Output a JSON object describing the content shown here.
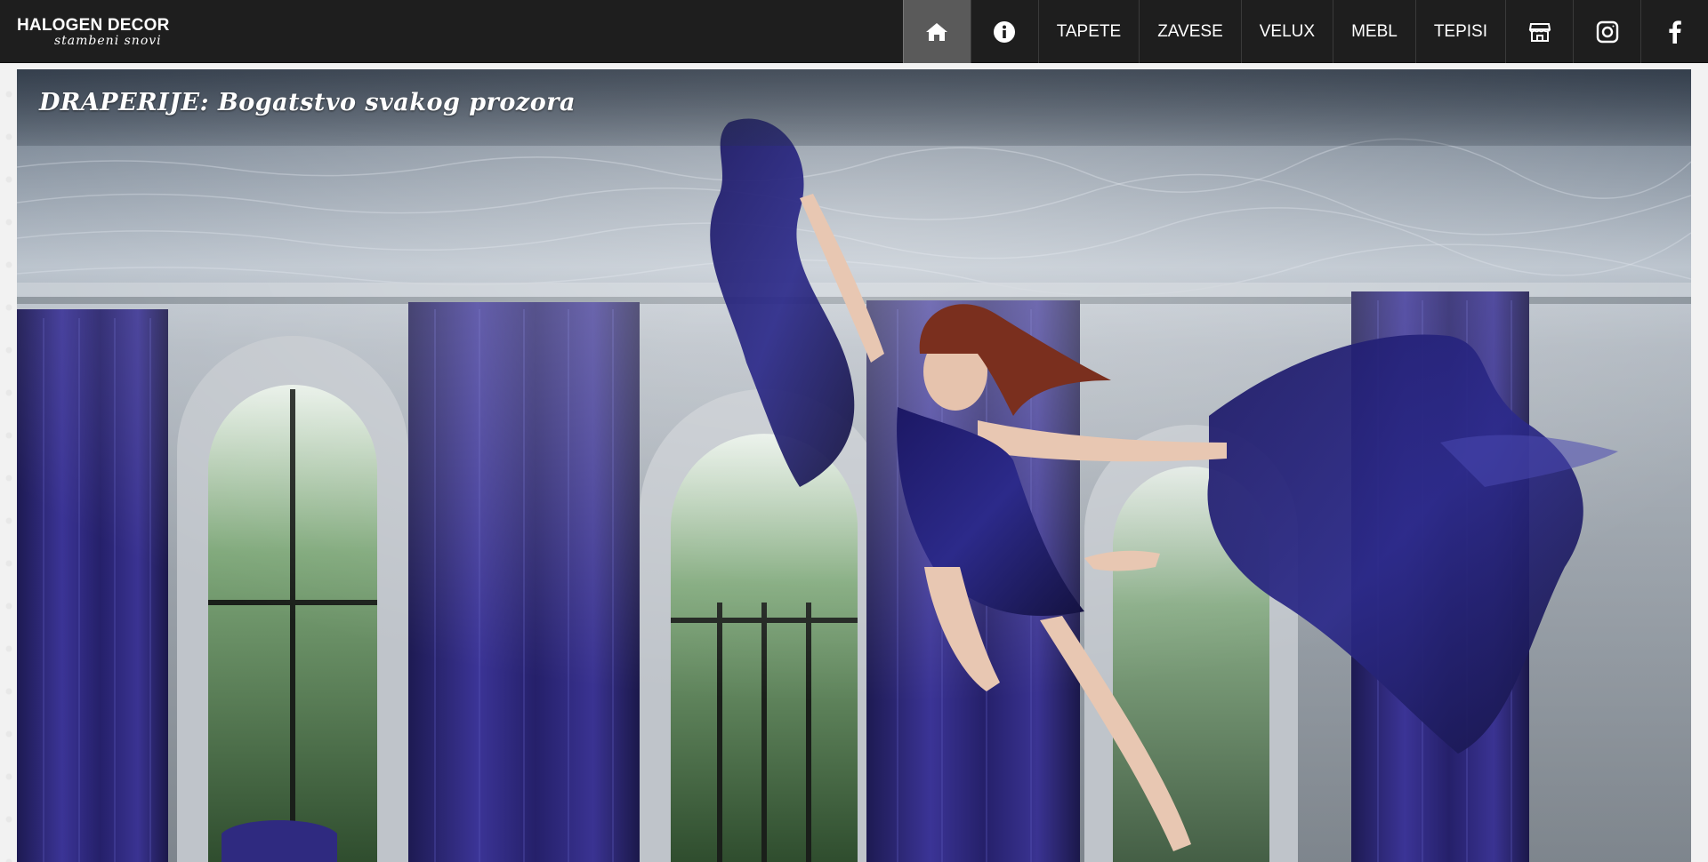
{
  "brand": {
    "name": "HALOGEN DECOR",
    "tagline": "stambeni snovi"
  },
  "nav": {
    "home_icon": "home-icon",
    "info_icon": "info-icon",
    "items": [
      {
        "label": "TAPETE"
      },
      {
        "label": "ZAVESE"
      },
      {
        "label": "VELUX"
      },
      {
        "label": "MEBL"
      },
      {
        "label": "TEPISI"
      }
    ],
    "store_icon": "store-icon",
    "instagram_icon": "instagram-icon",
    "facebook_icon": "facebook-icon"
  },
  "hero": {
    "title": "DRAPERIJE: Bogatstvo svakog prozora",
    "image": "underwater-woman-in-blue-dress-with-curtains"
  },
  "colors": {
    "topbar": "#1e1e1e",
    "home_active": "#5a5a5a",
    "curtain_blue": "#2a2570"
  }
}
